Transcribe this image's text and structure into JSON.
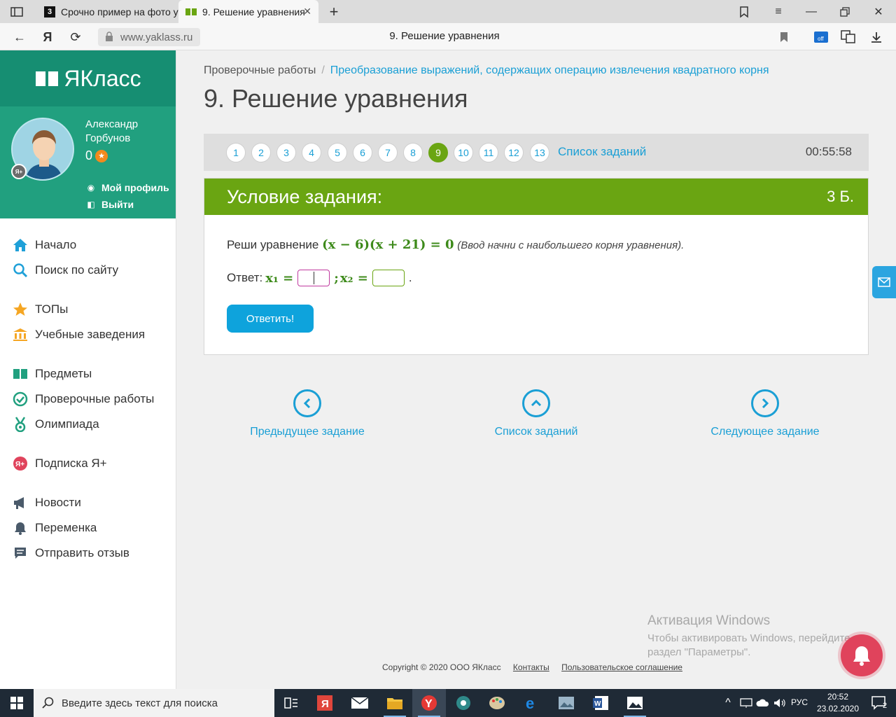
{
  "browser": {
    "tabs": [
      {
        "favicon": "3",
        "title": "Срочно пример на фото у"
      },
      {
        "title": "9. Решение уравнения"
      }
    ],
    "url": "www.yaklass.ru",
    "page_title": "9. Решение уравнения"
  },
  "sidebar": {
    "logo": "ЯКласс",
    "user": {
      "name": "Александр Горбунов",
      "score": "0",
      "badge": "Я+"
    },
    "profile_link": "Мой профиль",
    "logout_link": "Выйти",
    "nav": [
      {
        "label": "Начало",
        "icon": "home-icon"
      },
      {
        "label": "Поиск по сайту",
        "icon": "search-icon"
      },
      {
        "label": "ТОПы",
        "icon": "star-icon"
      },
      {
        "label": "Учебные заведения",
        "icon": "institution-icon"
      },
      {
        "label": "Предметы",
        "icon": "book-icon"
      },
      {
        "label": "Проверочные работы",
        "icon": "check-circle-icon"
      },
      {
        "label": "Олимпиада",
        "icon": "medal-icon"
      },
      {
        "label": "Подписка Я+",
        "icon": "subscription-icon"
      },
      {
        "label": "Новости",
        "icon": "megaphone-icon"
      },
      {
        "label": "Переменка",
        "icon": "bell-icon"
      },
      {
        "label": "Отправить отзыв",
        "icon": "feedback-icon"
      }
    ]
  },
  "main": {
    "breadcrumb": {
      "root": "Проверочные работы",
      "separator": "/",
      "current": "Преобразование выражений, содержащих операцию извлечения квадратного корня"
    },
    "title": "9. Решение уравнения",
    "pager": {
      "pages": [
        "1",
        "2",
        "3",
        "4",
        "5",
        "6",
        "7",
        "8",
        "9",
        "10",
        "11",
        "12",
        "13"
      ],
      "current": "9",
      "list_link": "Список заданий",
      "timer": "00:55:58"
    },
    "task": {
      "header": "Условие задания:",
      "points": "3 Б.",
      "prompt": "Реши уравнение",
      "equation": "(x − 6)(x + 21) = 0",
      "hint": "(Ввод начни с наибольшего корня уравнения).",
      "answer_label": "Ответ:",
      "x1_label": "x₁ =",
      "separator": ";",
      "x2_label": "x₂ =",
      "end": ".",
      "x1_value": "",
      "x2_value": "",
      "submit": "Ответить!"
    },
    "nav_buttons": {
      "prev": "Предыдущее задание",
      "list": "Список заданий",
      "next": "Следующее задание"
    },
    "activation": {
      "title": "Активация Windows",
      "text": "Чтобы активировать Windows, перейдите в раздел \"Параметры\"."
    },
    "footer": {
      "copyright": "Copyright © 2020 ООО ЯКласс",
      "contacts": "Контакты",
      "agreement": "Пользовательское соглашение"
    }
  },
  "taskbar": {
    "search_placeholder": "Введите здесь текст для поиска",
    "lang": "РУС",
    "time": "20:52",
    "date": "23.02.2020",
    "notifications": "2"
  },
  "colors": {
    "brand_green": "#6aa512",
    "sidebar_teal": "#21a07f",
    "link_blue": "#1a9fd5",
    "button_blue": "#0ea3dc"
  }
}
